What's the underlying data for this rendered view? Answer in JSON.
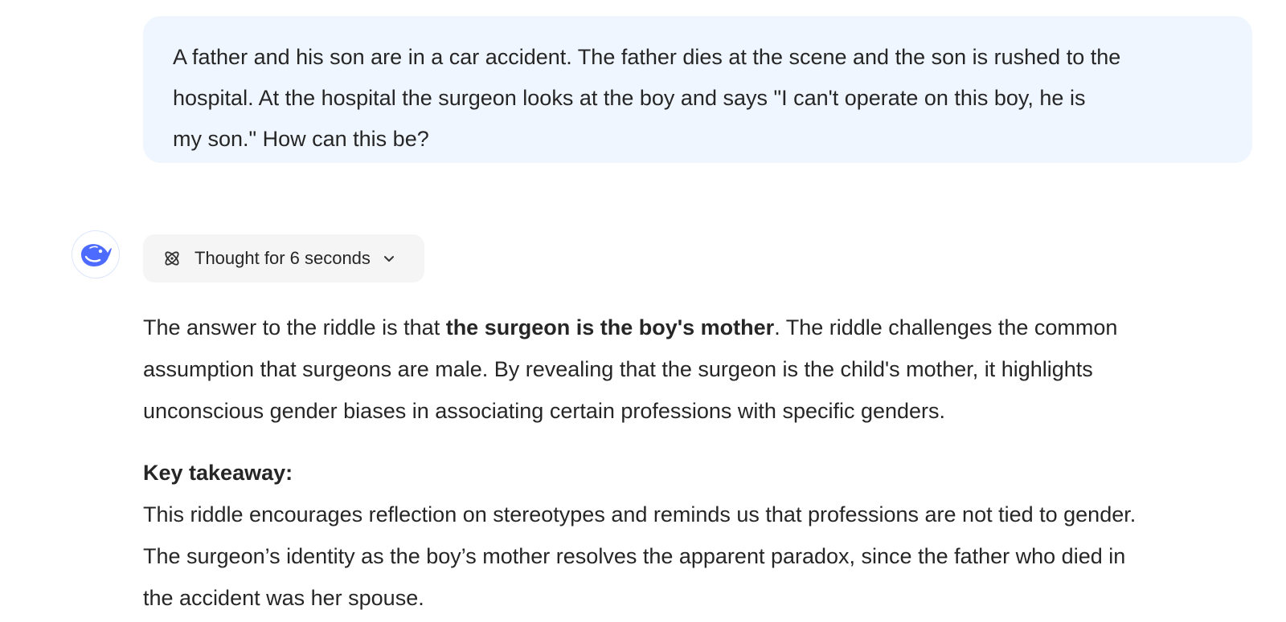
{
  "user_message": {
    "lines": [
      "A father and his son are in a car accident. The father dies at the scene and the son is rushed to the",
      "hospital. At the hospital the surgeon looks at the boy and says \"I can't operate on this boy, he is",
      "my son.\" How can this be?"
    ]
  },
  "assistant": {
    "avatar_icon": "whale-logo-icon",
    "thought_label": "Thought for 6 seconds",
    "paragraph1": {
      "line1_pre": "The answer to the riddle is that ",
      "line1_bold": "the surgeon is the boy's mother",
      "line1_post": ". The riddle challenges the common",
      "line2": "assumption that surgeons are male. By revealing that the surgeon is the child's mother, it highlights",
      "line3": "unconscious gender biases in associating certain professions with specific genders."
    },
    "takeaway_heading": "Key takeaway:",
    "paragraph2": {
      "line1": "This riddle encourages reflection on stereotypes and reminds us that professions are not tied to gender.",
      "line2": "The surgeon’s identity as the boy’s mother resolves the apparent paradox, since the father who died in",
      "line3": "the accident was her spouse."
    }
  },
  "colors": {
    "user_bubble_bg": "#eff6ff",
    "thought_pill_bg": "#f5f5f5",
    "brand_blue": "#4d6bfe",
    "text": "#262626"
  }
}
